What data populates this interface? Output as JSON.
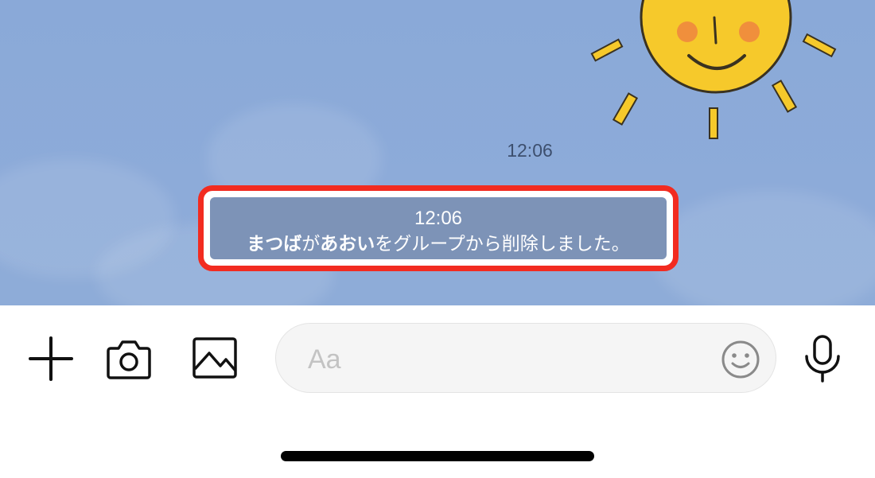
{
  "chat": {
    "timestamp": "12:06",
    "system_message": {
      "time": "12:06",
      "actor": "まつば",
      "particle": "が",
      "target": "あおい",
      "action": "をグループから削除しました。"
    }
  },
  "input_bar": {
    "placeholder": "Aa",
    "icons": [
      "plus-icon",
      "camera-icon",
      "image-icon",
      "emoji-icon",
      "microphone-icon"
    ]
  },
  "colors": {
    "chat_background": "#8aa9d8",
    "highlight_border": "#f22b20",
    "system_message_bg": "#7d93b7",
    "sun": "#f6c92b"
  }
}
